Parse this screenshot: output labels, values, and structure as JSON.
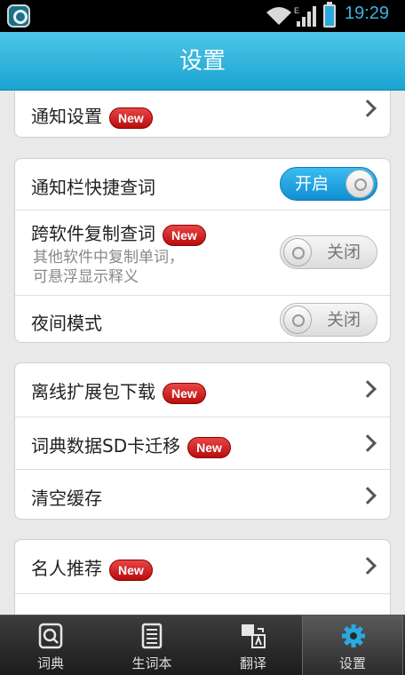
{
  "status_bar": {
    "time": "19:29",
    "network": "E"
  },
  "header": {
    "title": "设置"
  },
  "section1": {
    "items": [
      {
        "label": "通知设置",
        "badge": "New"
      }
    ]
  },
  "section2": {
    "items": [
      {
        "label": "通知栏快捷查词",
        "toggle": "开启"
      },
      {
        "label": "跨软件复制查词",
        "badge": "New",
        "desc_line1": "其他软件中复制单词，",
        "desc_line2": "可悬浮显示释义",
        "toggle": "关闭"
      },
      {
        "label": "夜间模式",
        "toggle": "关闭"
      }
    ]
  },
  "section3": {
    "items": [
      {
        "label": "离线扩展包下载",
        "badge": "New"
      },
      {
        "label": "词典数据SD卡迁移",
        "badge": "New"
      },
      {
        "label": "清空缓存"
      }
    ]
  },
  "section4": {
    "items": [
      {
        "label": "名人推荐",
        "badge": "New"
      }
    ]
  },
  "bottom_nav": {
    "items": [
      {
        "label": "词典",
        "icon": "dictionary-icon"
      },
      {
        "label": "生词本",
        "icon": "wordbook-icon"
      },
      {
        "label": "翻译",
        "icon": "translate-icon"
      },
      {
        "label": "设置",
        "icon": "gear-icon",
        "active": true
      }
    ]
  },
  "colors": {
    "accent": "#19a4d2",
    "badge": "#c81414",
    "toggle_on": "#118fd2"
  }
}
